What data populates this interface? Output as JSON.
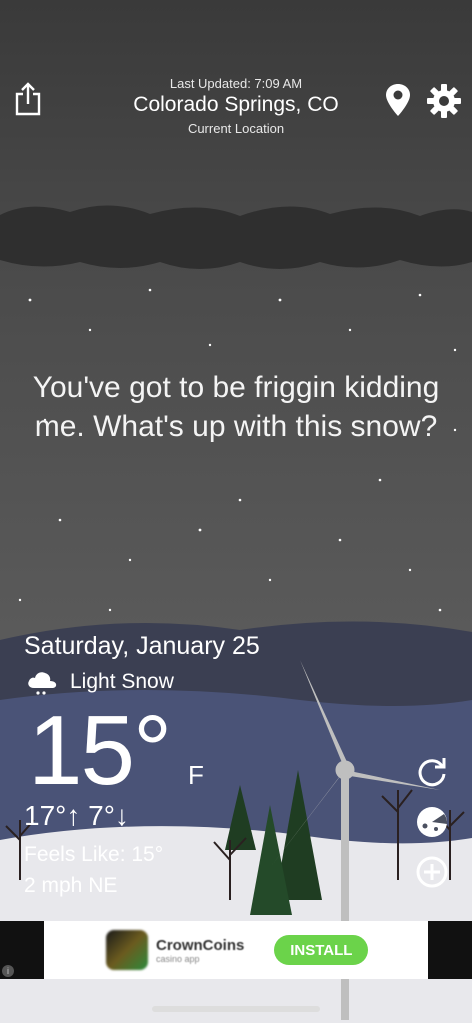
{
  "header": {
    "last_updated": "Last Updated: 7:09 AM",
    "city": "Colorado Springs, CO",
    "location_label": "Current Location"
  },
  "quote": "You've got to be friggin kidding me. What's up with this snow?",
  "weather": {
    "date": "Saturday, January 25",
    "condition": "Light Snow",
    "temperature": "15°",
    "unit": "F",
    "hi_lo": "17°↑ 7°↓",
    "feels_like": "Feels Like: 15°",
    "wind": "2 mph NE"
  },
  "ad": {
    "title": "CrownCoins",
    "subtitle": "casino app",
    "install_label": "INSTALL"
  },
  "icons": {
    "share": "share-icon",
    "location": "location-pin-icon",
    "settings": "gear-icon",
    "refresh": "refresh-icon",
    "radar": "radar-icon",
    "add": "add-icon",
    "condition": "cloud-snow-icon"
  }
}
